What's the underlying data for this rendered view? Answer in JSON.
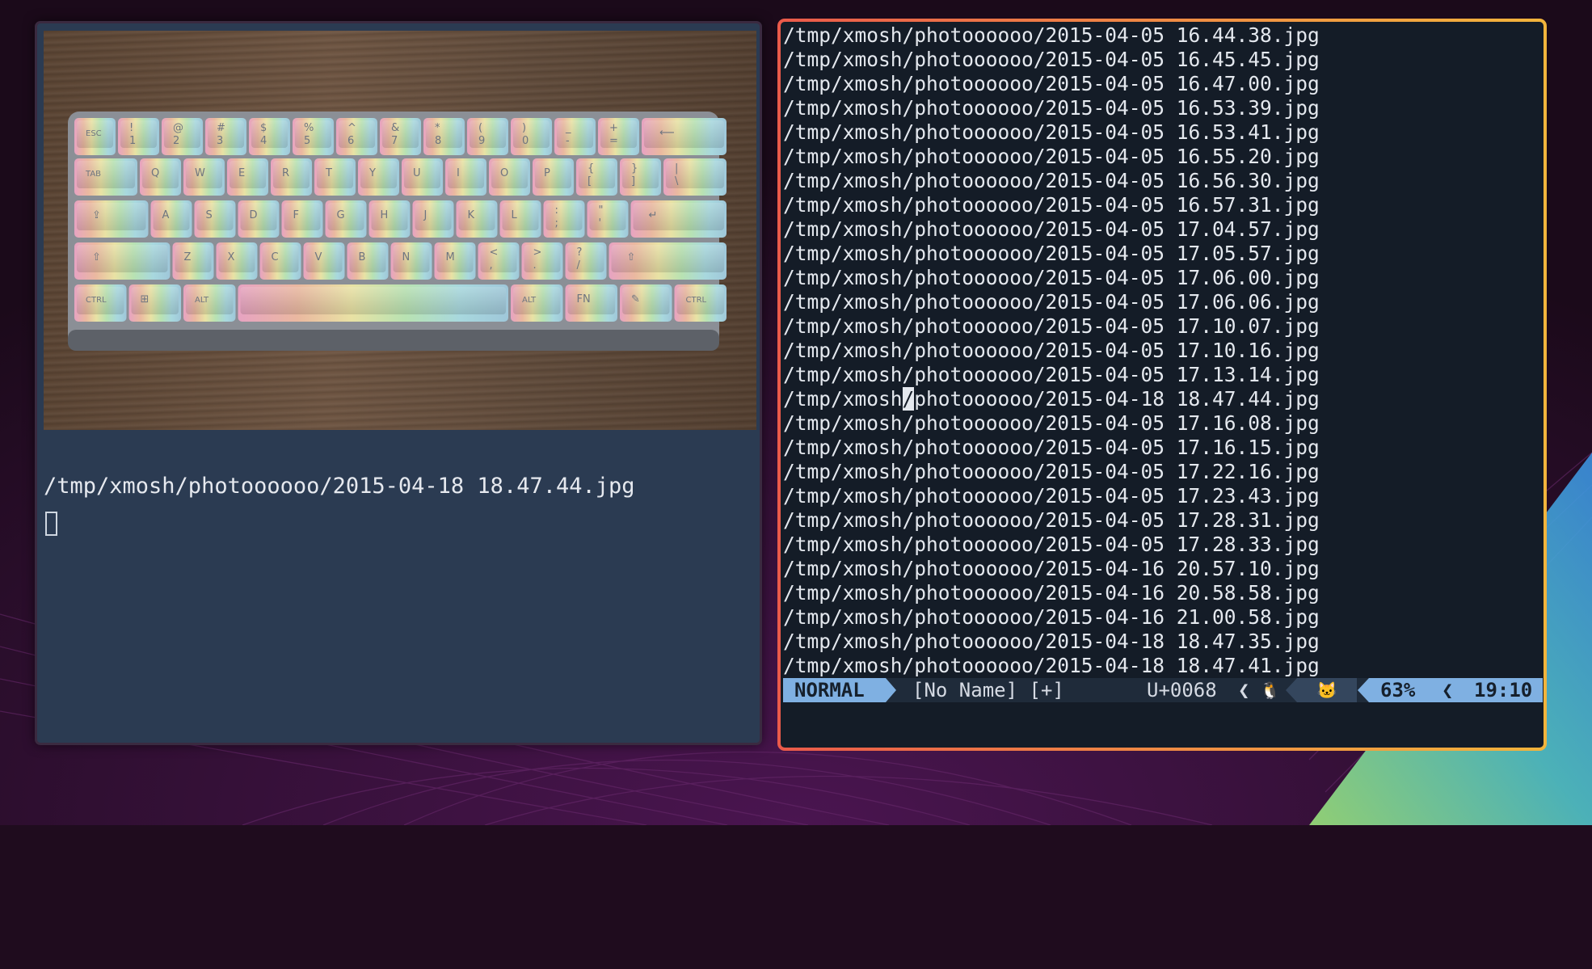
{
  "colors": {
    "window_bg": "#2b3b52",
    "vim_bg": "#141c27",
    "border_gradient_start": "#ea5a4a",
    "border_gradient_end": "#f2b43c",
    "statusline_accent": "#7fb0e2"
  },
  "terminal": {
    "output_line": "/tmp/xmosh/photoooooo/2015-04-18 18.47.44.jpg"
  },
  "vim": {
    "lines": [
      "/tmp/xmosh/photoooooo/2015-04-05 16.44.38.jpg",
      "/tmp/xmosh/photoooooo/2015-04-05 16.45.45.jpg",
      "/tmp/xmosh/photoooooo/2015-04-05 16.47.00.jpg",
      "/tmp/xmosh/photoooooo/2015-04-05 16.53.39.jpg",
      "/tmp/xmosh/photoooooo/2015-04-05 16.53.41.jpg",
      "/tmp/xmosh/photoooooo/2015-04-05 16.55.20.jpg",
      "/tmp/xmosh/photoooooo/2015-04-05 16.56.30.jpg",
      "/tmp/xmosh/photoooooo/2015-04-05 16.57.31.jpg",
      "/tmp/xmosh/photoooooo/2015-04-05 17.04.57.jpg",
      "/tmp/xmosh/photoooooo/2015-04-05 17.05.57.jpg",
      "/tmp/xmosh/photoooooo/2015-04-05 17.06.00.jpg",
      "/tmp/xmosh/photoooooo/2015-04-05 17.06.06.jpg",
      "/tmp/xmosh/photoooooo/2015-04-05 17.10.07.jpg",
      "/tmp/xmosh/photoooooo/2015-04-05 17.10.16.jpg",
      "/tmp/xmosh/photoooooo/2015-04-05 17.13.14.jpg",
      "/tmp/xmosh/photoooooo/2015-04-18 18.47.44.jpg",
      "/tmp/xmosh/photoooooo/2015-04-05 17.16.08.jpg",
      "/tmp/xmosh/photoooooo/2015-04-05 17.16.15.jpg",
      "/tmp/xmosh/photoooooo/2015-04-05 17.22.16.jpg",
      "/tmp/xmosh/photoooooo/2015-04-05 17.23.43.jpg",
      "/tmp/xmosh/photoooooo/2015-04-05 17.28.31.jpg",
      "/tmp/xmosh/photoooooo/2015-04-05 17.28.33.jpg",
      "/tmp/xmosh/photoooooo/2015-04-16 20.57.10.jpg",
      "/tmp/xmosh/photoooooo/2015-04-16 20.58.58.jpg",
      "/tmp/xmosh/photoooooo/2015-04-16 21.00.58.jpg",
      "/tmp/xmosh/photoooooo/2015-04-18 18.47.35.jpg",
      "/tmp/xmosh/photoooooo/2015-04-18 18.47.41.jpg"
    ],
    "cursor_line": 15,
    "cursor_col": 10,
    "statusline": {
      "mode": "NORMAL",
      "file": "[No Name] [+]",
      "char_code": "U+0068",
      "separator": "❮",
      "os_icon": "linux-penguin-icon",
      "os_glyph": "🐧",
      "filetype_icon": "cat-face-icon",
      "filetype_glyph": "🐱",
      "percent": "63%",
      "time": "19:10"
    }
  },
  "photo": {
    "keycap_rows": [
      [
        "ESC",
        "!\n1",
        "@\n2",
        "#\n3",
        "$\n4",
        "%\n5",
        "^\n6",
        "&\n7",
        "*\n8",
        "(\n9",
        ")\n0",
        "_\n-",
        "+\n=",
        "⟵"
      ],
      [
        "TAB",
        "Q",
        "W",
        "E",
        "R",
        "T",
        "Y",
        "U",
        "I",
        "O",
        "P",
        "{\n[",
        "}\n]",
        "|\n\\"
      ],
      [
        "⇪",
        "A",
        "S",
        "D",
        "F",
        "G",
        "H",
        "J",
        "K",
        "L",
        ":\n;",
        "\"\n'",
        "↵"
      ],
      [
        "⇧",
        "Z",
        "X",
        "C",
        "V",
        "B",
        "N",
        "M",
        "<\n,",
        ">\n.",
        "?\n/",
        "⇧"
      ],
      [
        "CTRL",
        "⊞",
        "ALT",
        "",
        "ALT",
        "FN",
        "✎",
        "CTRL"
      ]
    ]
  }
}
